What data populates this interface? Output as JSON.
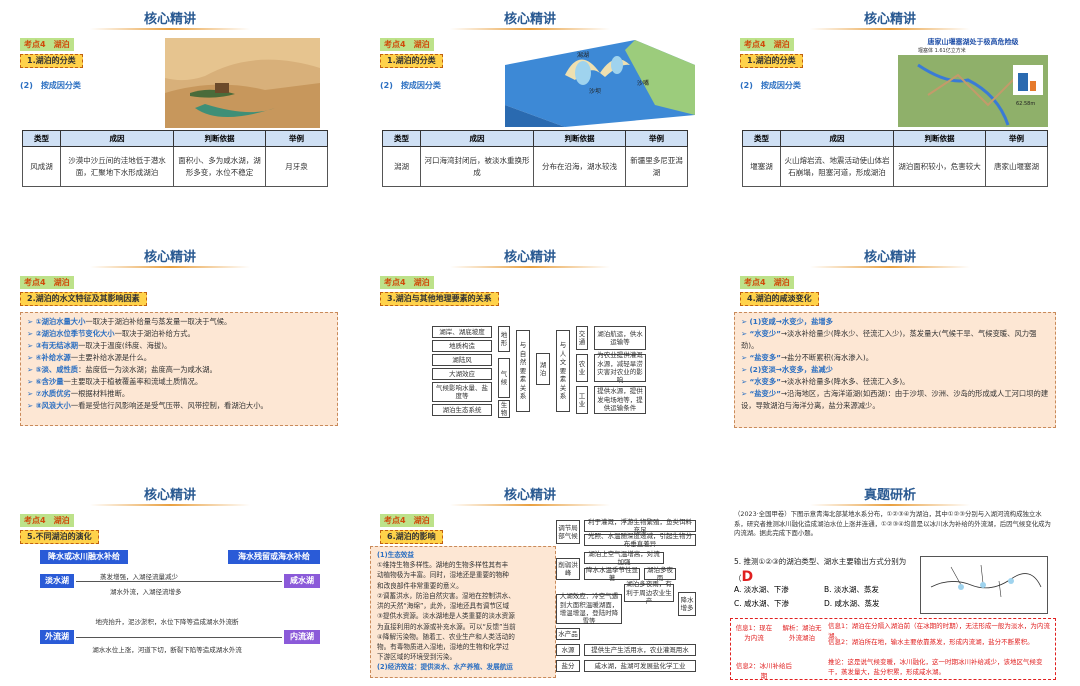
{
  "common": {
    "title": "核心精讲",
    "tag": "考点4　湖泊"
  },
  "s1": {
    "sec": "1.湖泊的分类",
    "sub": "(2)　按成因分类",
    "th": [
      "类型",
      "成因",
      "判断依据",
      "举例"
    ],
    "row": [
      "风成湖",
      "沙漠中沙丘间的洼地低于潜水面，汇聚地下水形成湖泊",
      "面积小、多为咸水湖，湖形多变，水位不稳定",
      "月牙泉"
    ]
  },
  "s2": {
    "sec": "1.湖泊的分类",
    "sub": "(2)　按成因分类",
    "th": [
      "类型",
      "成因",
      "判断依据",
      "举例"
    ],
    "row": [
      "潟湖",
      "河口海湾封闭后，被淡水重换形成",
      "分布在沿海，湖水较浅",
      "新疆里多尼亚潟湖"
    ],
    "img_labels": [
      "潟湖",
      "沙嘴",
      "沙坝"
    ]
  },
  "s3": {
    "sec": "1.湖泊的分类",
    "sub": "(2)　按成因分类",
    "th": [
      "类型",
      "成因",
      "判断依据",
      "举例"
    ],
    "row": [
      "堰塞湖",
      "火山熔岩流、地震活动使山体岩石崩塌，阻塞河道，形成湖泊",
      "湖泊面积较小，危害较大",
      "唐家山堰塞湖"
    ],
    "map_title": "唐家山堰塞湖处于极高危险级",
    "map_sub": "堰塞体 1.61亿立方米",
    "map_label": "62.58m"
  },
  "s4": {
    "sec": "2.湖泊的水文特征及其影响因素",
    "lines": [
      [
        "①湖泊水量大小",
        "一取决于湖泊补给量与蒸发量一取决于气候。"
      ],
      [
        "②湖泊水位季节变化大小",
        "一取决于湖泊补给方式。"
      ],
      [
        "③有无结冰期",
        "一取决于温度(纬度、海拔)。"
      ],
      [
        "④补给水源",
        "一主要补给水源是什么。"
      ],
      [
        "⑤淡、咸性质",
        "：盐度低一为淡水湖；盐度高一为咸水湖。"
      ],
      [
        "⑥含沙量",
        "一主要取决于植被覆盖率和流域土质情况。"
      ],
      [
        "⑦水质优劣",
        "一根据材料推断。"
      ],
      [
        "⑧风浪大小",
        "一看是受信行风影响还是受气压带、风带控制，看湖泊大小。"
      ]
    ]
  },
  "s5": {
    "sec": "3.湖泊与其他地理要素的关系",
    "left": [
      "湖岸、湖底坡度",
      "地质构造",
      "湖陆风",
      "大湖效应",
      "气候影响水量、盐度等",
      "湖泊生态系统"
    ],
    "mid": [
      "地形",
      "气候",
      "生物"
    ],
    "center1": "与自然要素关系",
    "core": "湖泊",
    "center2": "与人文要素关系",
    "rmid": [
      "交通",
      "农业",
      "工业"
    ],
    "right": [
      "湖泊航运，供水运输等",
      "为农业提供灌溉水源，减轻旱涝灾害对农业的影响",
      "提供水源，提供发电场地等，提供运输条件"
    ]
  },
  "s6": {
    "sec": "4.湖泊的咸淡变化",
    "lines": [
      [
        "(1)变咸→水变少，盐增多",
        ""
      ],
      [
        "“水变少”",
        "→淡水补给量少(降水少、径流汇入少)，蒸发量大(气候干旱、气候变暖、风力强劲)。"
      ],
      [
        "“盐变多”",
        "→盐分不断累积(海水渗入)。"
      ],
      [
        "(2)变淡→水变多，盐减少",
        ""
      ],
      [
        "“水变多”",
        "→淡水补给量多(降水多、径流汇入多)。"
      ],
      [
        "“盐变少”",
        "→沿海地区，古海洋道湖(如西湖)：由于沙坝、沙洲、沙岛的形成或人工河口坝的建设，导致湖泊与海洋分离，盐分来源减少。"
      ]
    ]
  },
  "s7": {
    "sec": "5.不同湖泊的演化",
    "top_left": "降水或冰川融水补给",
    "top_right": "海水残留或海水补给",
    "fresh": "淡水湖",
    "salt": "咸水湖",
    "outflow": "外流湖",
    "inflow": "内流湖",
    "t1": "蒸发增强，入湖径流量减少",
    "t2": "湖水外流，入湖径流增多",
    "t3": "地壳抬升，泥沙淤积，水位下降等造成湖水外流断",
    "t4": "湖水水位上涨，河道下切，断裂下陷等造成湖水外流"
  },
  "s8": {
    "sec": "6.湖泊的影响",
    "h1": "(1)生态效益",
    "lines": [
      "①维持生物多样性。湖地的生物多样性其有丰",
      "动植物极为丰富。同时，湿地还是重要的物种",
      "和改良部件非常重要的意义。",
      "②调蓄洪水，防治自然灾害。湿地在控制洪水、",
      "洪的天然“海绵”，此外，湿地还具有调节区域",
      "③提供水资源。淡水湖地是人类重要的淡水资源",
      "为直接利用的水源或补充水源。可以“反馈”当前",
      "④降解污染物。随着工、农业生产和人类活动的",
      "物。有毒物质进入湿地，湿地的生物和化学过",
      "下游区域的环境受到污染。",
      "(2)经济效益：提供淡水、水产养殖、发展航运"
    ],
    "chart": [
      "调节局部气候",
      "削弱洪峰",
      "水源",
      "盐分",
      "水产品",
      "降水增多"
    ],
    "chart_r": [
      "利于灌溉，浮游生物繁殖，鱼类饵料充足",
      "光照、水温随深度递减，引起生物分布垂直差异",
      "湖泊上空气温增高，对流加强",
      "降水水温季节性显著",
      "调节周边气候",
      "湖泊多夜雨",
      "湖泊多夜雨，有利于周边农业生产",
      "大湖效应：冷空气遇到大面积温暖湖面，增温增湿，登陆时降雪等",
      "提供生产生活用水，农业灌溉用水",
      "咸水湖，盐湖可发展盐化学工业"
    ]
  },
  "s9": {
    "title": "真题研析",
    "q": "（2023·全国甲卷）下图示意青海北部某地水系分布，①②③④为湖泊，其中①②③分别与入湖河流构成独立水系，研究者推测冰川融化造成湖泊水位上涨并连通，①②③④均曾是以冰川水为补给的外流湖，后因气候变化成为内流湖。据此完成下面小题。",
    "qnum": "5. 推测①②③的湖泊类型、湖水主要输出方式分别为（",
    "answer": "D",
    "opts": [
      "A. 淡水湖、下渗",
      "B. 淡水湖、蒸发",
      "C. 咸水湖、下渗",
      "D. 咸水湖、蒸发"
    ],
    "h1": "信息1：现在为内流",
    "h2": "解析：湖泊无外流湖泊",
    "r1": "信息1：湖泊在分隔入湖泊前（在冰期的时期），无法形成一般为淡水，为内流湖。",
    "r2": "信息2：湖泊所在地，输水主要依靠蒸发，形成内流湖，盐分不断累积。",
    "h3": "信息2：冰川补给后期",
    "r3": "推论：这是说气候变暖，冰川融化，这一时期冰川补给减少，该地区气候变干，蒸发量大，盐分积累，形成咸水湖。"
  }
}
